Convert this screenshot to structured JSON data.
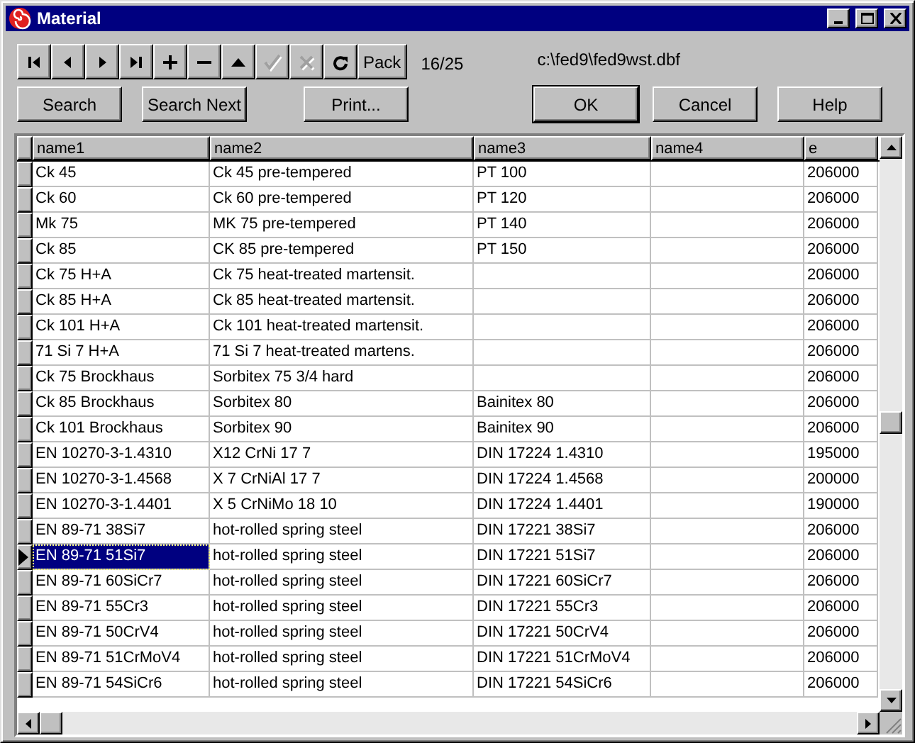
{
  "window": {
    "title": "Material"
  },
  "toolbar": {
    "buttons": [
      {
        "kind": "first",
        "disabled": false
      },
      {
        "kind": "prior",
        "disabled": false
      },
      {
        "kind": "next",
        "disabled": false
      },
      {
        "kind": "last",
        "disabled": false
      },
      {
        "kind": "insert",
        "disabled": false
      },
      {
        "kind": "delete",
        "disabled": false
      },
      {
        "kind": "edit",
        "disabled": false
      },
      {
        "kind": "post",
        "disabled": true
      },
      {
        "kind": "cancel",
        "disabled": true
      },
      {
        "kind": "refresh",
        "disabled": false
      },
      {
        "kind": "text",
        "label": "Pack",
        "disabled": false
      }
    ],
    "record_counter": "16/25",
    "file_path": "c:\\fed9\\fed9wst.dbf"
  },
  "buttons": [
    {
      "label": "Search",
      "default": false
    },
    {
      "label": "Search Next",
      "default": false
    },
    {
      "label": "Print...",
      "default": false
    },
    {
      "label": "OK",
      "default": true
    },
    {
      "label": "Cancel",
      "default": false
    },
    {
      "label": "Help",
      "default": false
    }
  ],
  "table": {
    "columns": [
      "name1",
      "name2",
      "name3",
      "name4",
      "e"
    ],
    "rows": [
      {
        "selected": false,
        "cells": [
          "Ck 45",
          "Ck 45 pre-tempered",
          "PT 100",
          null,
          "206000"
        ]
      },
      {
        "selected": false,
        "cells": [
          "Ck 60",
          "Ck 60 pre-tempered",
          "PT 120",
          null,
          "206000"
        ]
      },
      {
        "selected": false,
        "cells": [
          "Mk 75",
          "MK 75 pre-tempered",
          "PT 140",
          null,
          "206000"
        ]
      },
      {
        "selected": false,
        "cells": [
          "Ck 85",
          "CK 85 pre-tempered",
          "PT 150",
          null,
          "206000"
        ]
      },
      {
        "selected": false,
        "cells": [
          "Ck 75 H+A",
          "Ck 75 heat-treated martensit.",
          null,
          null,
          "206000"
        ]
      },
      {
        "selected": false,
        "cells": [
          "Ck 85 H+A",
          "Ck 85 heat-treated martensit.",
          null,
          null,
          "206000"
        ]
      },
      {
        "selected": false,
        "cells": [
          "Ck 101 H+A",
          "Ck 101 heat-treated martensit.",
          null,
          null,
          "206000"
        ]
      },
      {
        "selected": false,
        "cells": [
          "71 Si 7 H+A",
          "71 Si 7 heat-treated martens.",
          null,
          null,
          "206000"
        ]
      },
      {
        "selected": false,
        "cells": [
          "Ck 75 Brockhaus",
          "Sorbitex 75  3/4 hard",
          null,
          null,
          "206000"
        ]
      },
      {
        "selected": false,
        "cells": [
          "Ck 85 Brockhaus",
          "Sorbitex 80",
          "Bainitex 80",
          null,
          "206000"
        ]
      },
      {
        "selected": false,
        "cells": [
          "Ck 101 Brockhaus",
          "Sorbitex 90",
          "Bainitex 90",
          null,
          "206000"
        ]
      },
      {
        "selected": false,
        "cells": [
          "EN 10270-3-1.4310",
          "X12 CrNi 17 7",
          "DIN 17224 1.4310",
          null,
          "195000"
        ]
      },
      {
        "selected": false,
        "cells": [
          "EN 10270-3-1.4568",
          "X 7 CrNiAl 17 7",
          "DIN 17224 1.4568",
          null,
          "200000"
        ]
      },
      {
        "selected": false,
        "cells": [
          "EN 10270-3-1.4401",
          "X 5 CrNiMo 18 10",
          "DIN 17224 1.4401",
          null,
          "190000"
        ]
      },
      {
        "selected": false,
        "cells": [
          "EN 89-71 38Si7",
          "hot-rolled spring steel",
          "DIN 17221 38Si7",
          null,
          "206000"
        ]
      },
      {
        "selected": true,
        "cells": [
          "EN 89-71 51Si7",
          "hot-rolled spring steel",
          "DIN 17221 51Si7",
          null,
          "206000"
        ]
      },
      {
        "selected": false,
        "cells": [
          "EN 89-71 60SiCr7",
          "hot-rolled spring steel",
          "DIN 17221 60SiCr7",
          null,
          "206000"
        ]
      },
      {
        "selected": false,
        "cells": [
          "EN 89-71 55Cr3",
          "hot-rolled spring steel",
          "DIN 17221 55Cr3",
          null,
          "206000"
        ]
      },
      {
        "selected": false,
        "cells": [
          "EN 89-71 50CrV4",
          "hot-rolled spring steel",
          "DIN 17221 50CrV4",
          null,
          "206000"
        ]
      },
      {
        "selected": false,
        "cells": [
          "EN 89-71 51CrMoV4",
          "hot-rolled spring steel",
          "DIN 17221 51CrMoV4",
          null,
          "206000"
        ]
      },
      {
        "selected": false,
        "cells": [
          "EN 89-71 54SiCr6",
          "hot-rolled spring steel",
          "DIN 17221 54SiCr6",
          null,
          "206000"
        ]
      }
    ]
  }
}
